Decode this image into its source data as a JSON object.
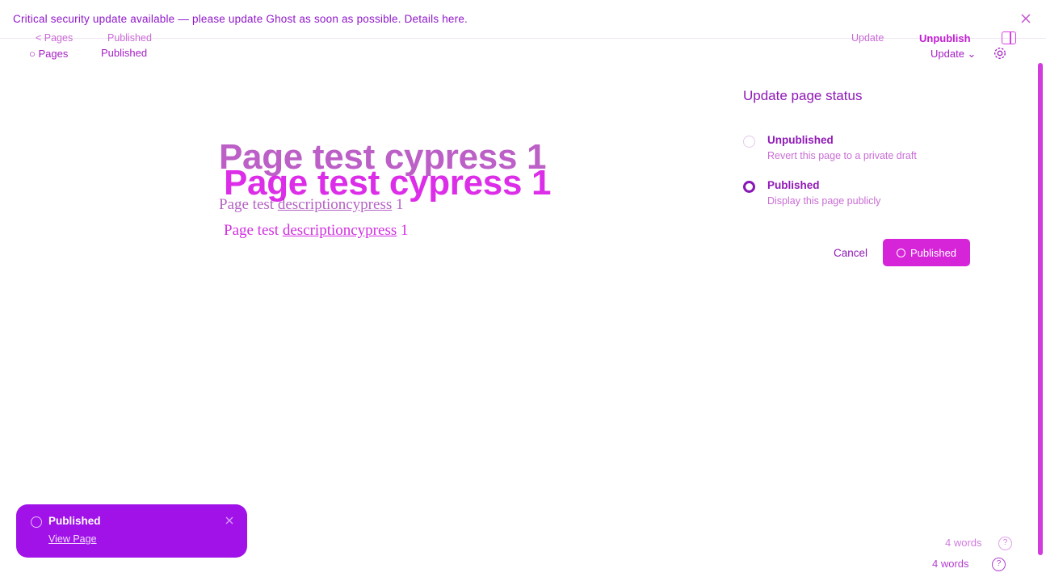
{
  "banner": {
    "text": "Critical security update available — please update Ghost as soon as possible. Details here.",
    "close_icon": "close-icon"
  },
  "header": {
    "ghost_back_label": "< Pages",
    "ghost_status": "Published",
    "back_label": "Pages",
    "status": "Published",
    "ghost_update_label": "Update",
    "unpublish_label": "Unpublish",
    "update_label": "Update",
    "sidebar_icon": "sidebar-toggle-icon",
    "settings_icon": "gear-icon"
  },
  "editor": {
    "title": "Page test cypress 1",
    "description_prefix": "Page test",
    "description_link": "descriptioncypress",
    "description_suffix": "1"
  },
  "publish_panel": {
    "title": "Update page status",
    "options": [
      {
        "label": "Unpublished",
        "description": "Revert this page to a private draft",
        "selected": false
      },
      {
        "label": "Published",
        "description": "Display this page publicly",
        "selected": true
      }
    ],
    "cancel_label": "Cancel",
    "confirm_label": "Published"
  },
  "toast": {
    "title": "Published",
    "link_label": "View Page"
  },
  "footer": {
    "word_count_ghost": "4 words",
    "word_count": "4 words",
    "help_label": "?"
  },
  "colors": {
    "accent": "#d624d8",
    "toast": "#a012e8",
    "text": "#8f19b6"
  }
}
